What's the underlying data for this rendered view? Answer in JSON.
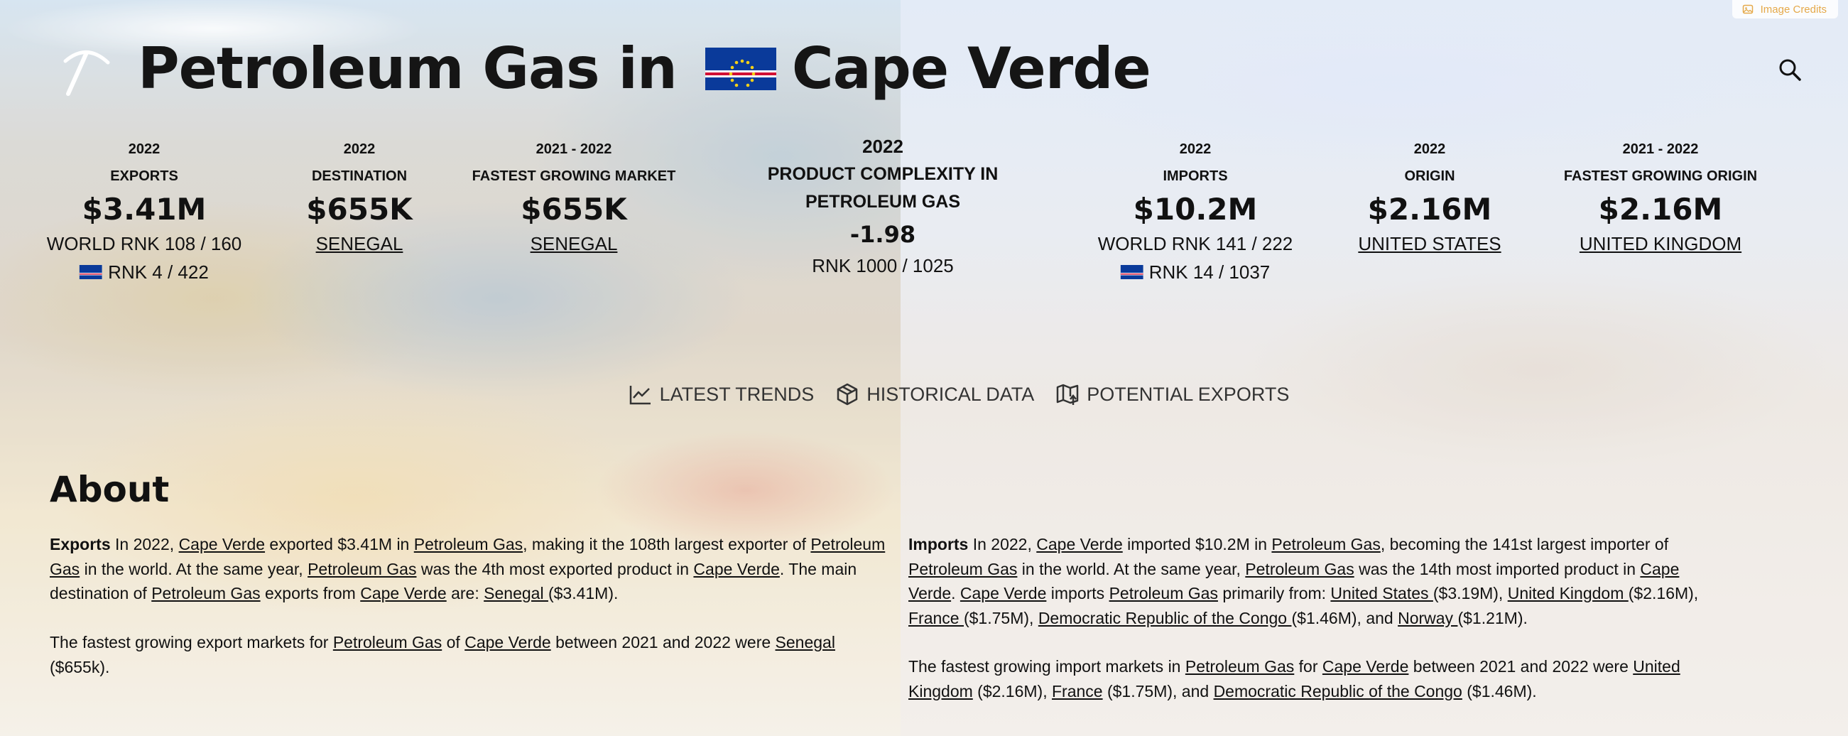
{
  "credits": {
    "label": "Image Credits",
    "icon": "image-icon",
    "color": "#e5a94a"
  },
  "header": {
    "title_prefix": "Petroleum Gas in",
    "country": "Cape Verde",
    "logo_icon": "pickaxe-icon",
    "search_icon": "search-icon"
  },
  "exports": {
    "value_block": {
      "year": "2022",
      "label": "EXPORTS",
      "value": "$3.41M",
      "world_rank": "WORLD RNK 108 / 160",
      "country_rank": "RNK 4 / 422"
    },
    "destination": {
      "year": "2022",
      "label": "DESTINATION",
      "value": "$655K",
      "link": "SENEGAL"
    },
    "fastest": {
      "year": "2021 - 2022",
      "label": "FASTEST GROWING MARKET",
      "value": "$655K",
      "link": "SENEGAL"
    }
  },
  "complexity": {
    "year": "2022",
    "label_line1": "PRODUCT COMPLEXITY IN",
    "label_line2": "PETROLEUM GAS",
    "value": "-1.98",
    "rank": "RNK 1000 / 1025"
  },
  "imports": {
    "value_block": {
      "year": "2022",
      "label": "IMPORTS",
      "value": "$10.2M",
      "world_rank": "WORLD RNK 141 / 222",
      "country_rank": "RNK 14 / 1037"
    },
    "origin": {
      "year": "2022",
      "label": "ORIGIN",
      "value": "$2.16M",
      "link": "UNITED STATES"
    },
    "fastest": {
      "year": "2021 - 2022",
      "label": "FASTEST GROWING ORIGIN",
      "value": "$2.16M",
      "link": "UNITED KINGDOM"
    }
  },
  "tabs": [
    {
      "label": "LATEST TRENDS",
      "icon": "trend-line-icon"
    },
    {
      "label": "HISTORICAL DATA",
      "icon": "cube-icon"
    },
    {
      "label": "POTENTIAL EXPORTS",
      "icon": "map-arrow-icon"
    }
  ],
  "about": {
    "heading": "About",
    "exports_p1": {
      "lead": "Exports",
      "t1": " In 2022, ",
      "l1": "Cape Verde",
      "t2": " exported $3.41M in ",
      "l2": "Petroleum Gas",
      "t3": ", making it the 108th largest exporter of ",
      "l3": "Petroleum Gas",
      "t4": " in the world. At the same year, ",
      "l4": "Petroleum Gas",
      "t5": " was the 4th most exported product in ",
      "l5": "Cape Verde",
      "t6": ". The main destination of ",
      "l6": "Petroleum Gas",
      "t7": " exports from ",
      "l7": "Cape Verde",
      "t8": " are: ",
      "l8": "Senegal ",
      "t9": "($3.41M)."
    },
    "exports_p2": {
      "t1": "The fastest growing export markets for ",
      "l1": "Petroleum Gas",
      "t2": " of ",
      "l2": "Cape Verde",
      "t3": " between 2021 and 2022 were ",
      "l3": "Senegal",
      "t4": " ($655k)."
    },
    "imports_p1": {
      "lead": "Imports",
      "t1": " In 2022, ",
      "l1": "Cape Verde",
      "t2": " imported $10.2M in ",
      "l2": "Petroleum Gas",
      "t3": ", becoming the 141st largest importer of ",
      "l3": "Petroleum Gas",
      "t4": " in the world. At the same year, ",
      "l4": "Petroleum Gas",
      "t5": " was the 14th most imported product in ",
      "l5": "Cape Verde",
      "t6": ". ",
      "l6": "Cape Verde",
      "t7": " imports ",
      "l7": "Petroleum Gas",
      "t8": " primarily from: ",
      "l8": "United States ",
      "t9": "($3.19M), ",
      "l9": "United Kingdom ",
      "t10": "($2.16M), ",
      "l10": "France ",
      "t11": "($1.75M), ",
      "l11": "Democratic Republic of the Congo ",
      "t12": "($1.46M), and ",
      "l12": "Norway ",
      "t13": "($1.21M)."
    },
    "imports_p2": {
      "t1": "The fastest growing import markets in ",
      "l1": "Petroleum Gas",
      "t2": " for ",
      "l2": "Cape Verde",
      "t3": " between 2021 and 2022 were ",
      "l3": "United Kingdom",
      "t4": " ($2.16M), ",
      "l4": "France",
      "t5": " ($1.75M), and ",
      "l5": "Democratic Republic of the Congo",
      "t6": " ($1.46M)."
    }
  }
}
